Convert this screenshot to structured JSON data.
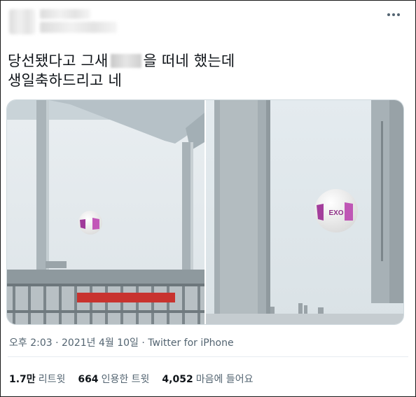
{
  "author": {
    "name_hidden": true
  },
  "tweet": {
    "text_part1": "당선됐다고 그새",
    "text_part2": "을 떠네 했는데",
    "text_line2": "생일축하드리고 네"
  },
  "photo_right": {
    "balloon_text": "EXO"
  },
  "meta": {
    "time": "오후 2:03",
    "separator1": " · ",
    "date": "2021년 4월 10일",
    "separator2": " · ",
    "client": "Twitter for iPhone"
  },
  "stats": {
    "retweets_count": "1.7만",
    "retweets_label": "리트윗",
    "quotes_count": "664",
    "quotes_label": "인용한 트윗",
    "likes_count": "4,052",
    "likes_label": "마음에 들어요"
  },
  "colors": {
    "text": "#0f1419",
    "secondary": "#536471",
    "border": "#cfd9de"
  }
}
